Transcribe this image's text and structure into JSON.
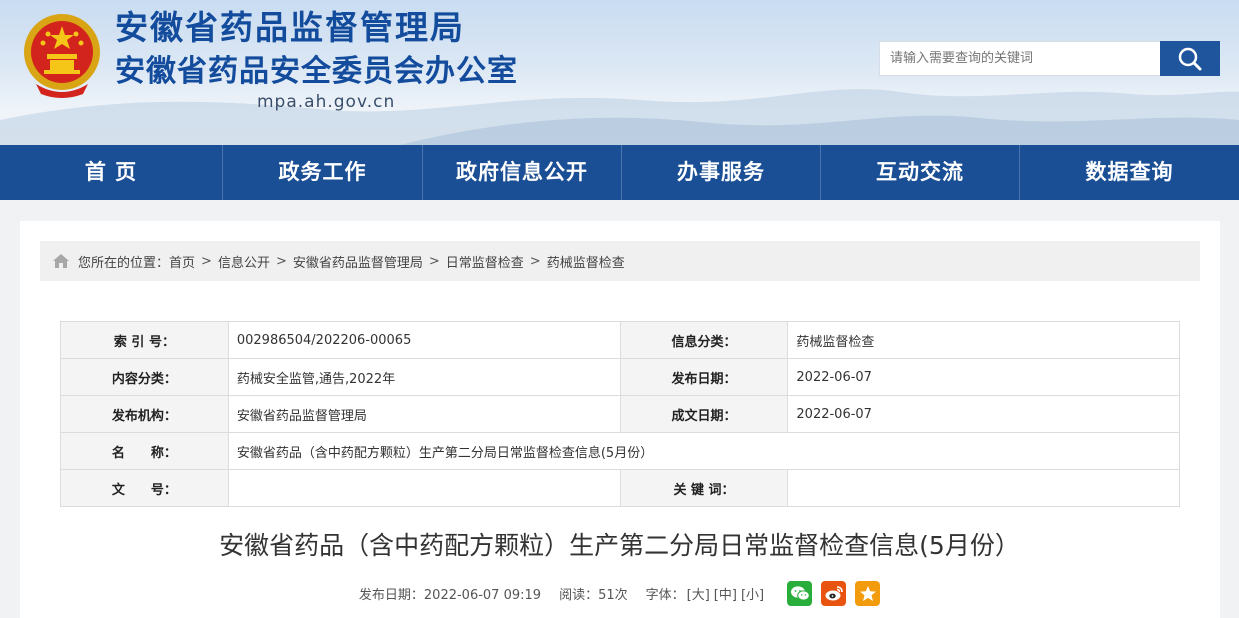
{
  "header": {
    "title_line1": "安徽省药品监督管理局",
    "title_line2": "安徽省药品安全委员会办公室",
    "domain": "mpa.ah.gov.cn",
    "emblem_icon": "national-emblem-icon"
  },
  "search": {
    "placeholder": "请输入需要查询的关键词",
    "button_icon": "search-icon"
  },
  "nav": {
    "items": [
      "首 页",
      "政务工作",
      "政府信息公开",
      "办事服务",
      "互动交流",
      "数据查询"
    ]
  },
  "breadcrumb": {
    "prefix": "您所在的位置：",
    "items": [
      "首页",
      "信息公开",
      "安徽省药品监督管理局",
      "日常监督检查",
      "药械监督检查"
    ],
    "separator": ">",
    "icon": "home-icon"
  },
  "meta": {
    "index_label": "索 引 号：",
    "index_value": "002986504/202206-00065",
    "category_label": "信息分类：",
    "category_value": "药械监督检查",
    "content_label": "内容分类：",
    "content_value": "药械安全监管,通告,2022年",
    "pubdate_label": "发布日期：",
    "pubdate_value": "2022-06-07",
    "org_label": "发布机构：",
    "org_value": "安徽省药品监督管理局",
    "made_label": "成文日期：",
    "made_value": "2022-06-07",
    "name_label": "名　　称：",
    "name_value": "安徽省药品（含中药配方颗粒）生产第二分局日常监督检查信息(5月份）",
    "docno_label": "文　　号：",
    "docno_value": "",
    "keywords_label": "关 键 词：",
    "keywords_value": ""
  },
  "article": {
    "title": "安徽省药品（含中药配方颗粒）生产第二分局日常监督检查信息(5月份）",
    "pub_info": "发布日期：2022-06-07 09:19",
    "reads": "阅读：51次",
    "font_label": "字体：",
    "font_large": "[大]",
    "font_medium": "[中]",
    "font_small": "[小]"
  },
  "share": {
    "wechat_color": "#2aae3b",
    "weibo_color": "#e8540f",
    "favorite_color": "#f29b0c"
  }
}
